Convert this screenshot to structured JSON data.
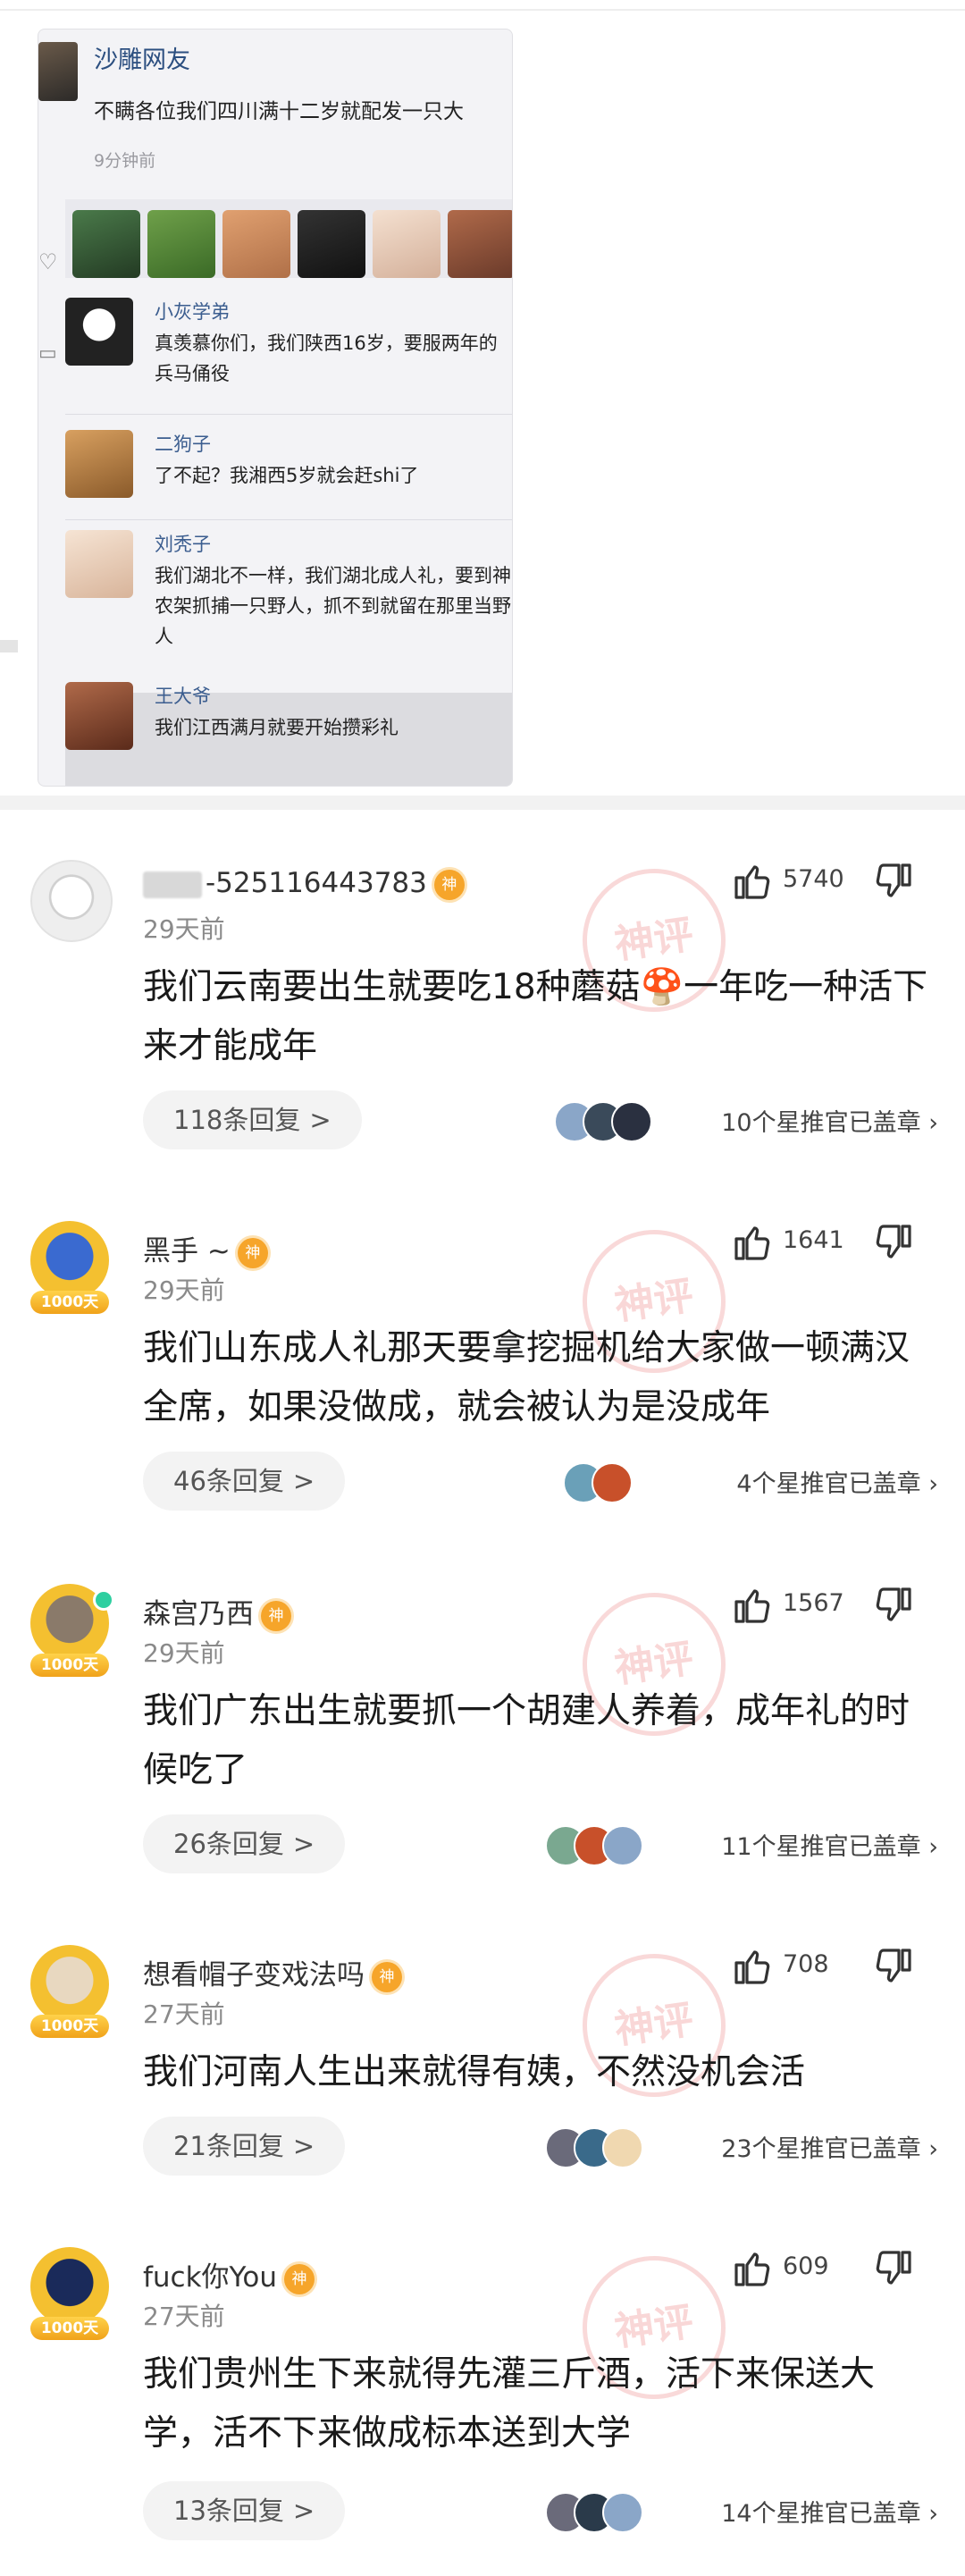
{
  "embed": {
    "post": {
      "user": "沙雕网友",
      "text": "不瞒各位我们四川满十二岁就配发一只大",
      "time": "9分钟前"
    },
    "replies": [
      {
        "name": "小灰学弟",
        "text": "真羡慕你们，我们陕西16岁，要服两年的兵马俑役"
      },
      {
        "name": "二狗子",
        "text": "了不起？我湘西5岁就会赶shi了"
      },
      {
        "name": "刘秃子",
        "text": "我们湖北不一样，我们湖北成人礼，要到神农架抓捕一只野人，抓不到就留在那里当野人"
      },
      {
        "name": "王大爷",
        "text": "我们江西满月就要开始攒彩礼"
      }
    ],
    "icons": {
      "heart": "heart-icon",
      "comment": "comment-icon"
    }
  },
  "comments": [
    {
      "user": "-525116443783",
      "time": "29天前",
      "likes": "5740",
      "text": "我们云南要出生就要吃18种蘑菇🍄一年吃一种活下来才能成年",
      "replies": "118条回复",
      "stars": "10个星推官已盖章",
      "badge": "神",
      "stamp": "神评"
    },
    {
      "user": "黑手 ~",
      "time": "29天前",
      "likes": "1641",
      "text": "我们山东成人礼那天要拿挖掘机给大家做一顿满汉全席，如果没做成，就会被认为是没成年",
      "replies": "46条回复",
      "stars": "4个星推官已盖章",
      "badge": "神",
      "level": "1000天",
      "stamp": "神评"
    },
    {
      "user": "森宫乃西",
      "time": "29天前",
      "likes": "1567",
      "text": "我们广东出生就要抓一个胡建人养着，成年礼的时候吃了",
      "replies": "26条回复",
      "stars": "11个星推官已盖章",
      "badge": "神",
      "level": "1000天",
      "stamp": "神评"
    },
    {
      "user": "想看帽子变戏法吗",
      "time": "27天前",
      "likes": "708",
      "text": "我们河南人生出来就得有姨，不然没机会活",
      "replies": "21条回复",
      "stars": "23个星推官已盖章",
      "badge": "神",
      "level": "1000天",
      "stamp": "神评"
    },
    {
      "user": "fuck你You",
      "time": "27天前",
      "likes": "609",
      "text": "我们贵州生下来就得先灌三斤酒，活下来保送大学，活不下来做成标本送到大学",
      "replies": "13条回复",
      "stars": "14个星推官已盖章",
      "badge": "神",
      "level": "1000天",
      "stamp": "神评"
    }
  ],
  "chevron": ">",
  "star_chevron": "›",
  "colors": {
    "badge": "#f6a52a",
    "level": "#f0a21a",
    "online": "#2ecfa0",
    "link": "#2c4f80"
  }
}
